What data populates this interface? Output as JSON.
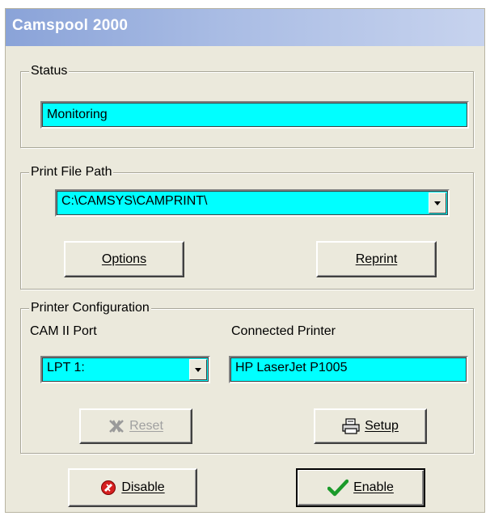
{
  "window": {
    "title": "Camspool 2000"
  },
  "status_group": {
    "label": "Status",
    "value": "Monitoring"
  },
  "print_path_group": {
    "label": "Print File Path",
    "path_value": "C:\\CAMSYS\\CAMPRINT\\",
    "options_button": "Options",
    "reprint_button": "Reprint"
  },
  "printer_group": {
    "label": "Printer Configuration",
    "port_label": "CAM II Port",
    "port_value": "LPT 1:",
    "printer_label": "Connected Printer",
    "printer_value": "HP LaserJet P1005",
    "reset_button": "Reset",
    "setup_button": "Setup"
  },
  "footer": {
    "disable_button": "Disable",
    "enable_button": "Enable"
  },
  "colors": {
    "field_bg": "#00ffff",
    "dialog_bg": "#ebe9dc",
    "enable_check": "#1b9a2a",
    "disable_icon": "#d62020"
  },
  "icons": {
    "path_dropdown": "chevron-down-icon",
    "port_dropdown": "chevron-down-icon",
    "reset": "reset-x-icon",
    "setup": "printer-icon",
    "disable": "no-entry-icon",
    "enable": "checkmark-icon"
  }
}
